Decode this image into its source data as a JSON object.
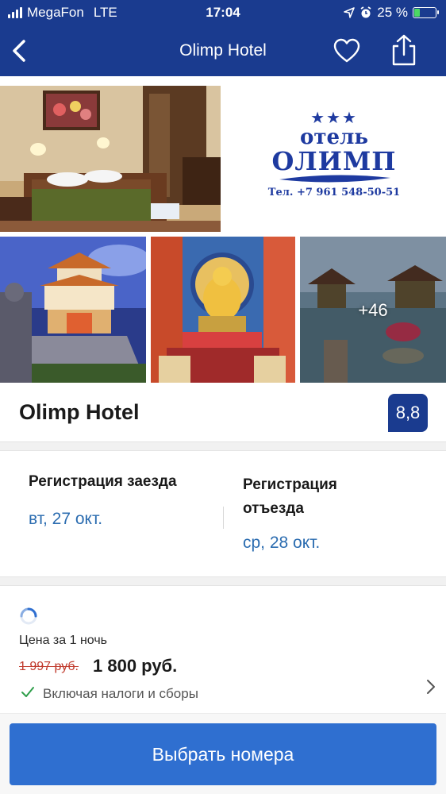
{
  "status_bar": {
    "carrier": "MegaFon",
    "network": "LTE",
    "time": "17:04",
    "battery_percent": "25 %",
    "battery_level": 0.25
  },
  "navbar": {
    "title": "Olimp Hotel"
  },
  "gallery": {
    "more_photos": "+46",
    "logo": {
      "stars": "★★★",
      "line1": "отель",
      "line2": "ОЛИМП",
      "phone": "Тел. +7 961 548-50-51"
    }
  },
  "hotel": {
    "name": "Olimp Hotel",
    "score": "8,8"
  },
  "dates": {
    "checkin_title": "Регистрация заезда",
    "checkin_date": "вт, 27 окт.",
    "checkout_title": "Регистрация отъезда",
    "checkout_date": "ср, 28 окт."
  },
  "price": {
    "label": "Цена за 1 ночь",
    "old_price": "1 997 руб.",
    "new_price": "1 800 руб.",
    "taxes_note": "Включая налоги и сборы"
  },
  "cta": {
    "label": "Выбрать номера"
  },
  "colors": {
    "brand_blue": "#1a3b8f",
    "button_blue": "#2f6fd0",
    "link_blue": "#2b6cb0",
    "strike_red": "#c0392b",
    "check_green": "#2e9e4a"
  },
  "icons": [
    "back-chevron-icon",
    "heart-icon",
    "share-icon",
    "location-arrow-icon",
    "alarm-icon",
    "battery-icon",
    "spinner-icon",
    "check-icon",
    "chevron-right-icon"
  ]
}
